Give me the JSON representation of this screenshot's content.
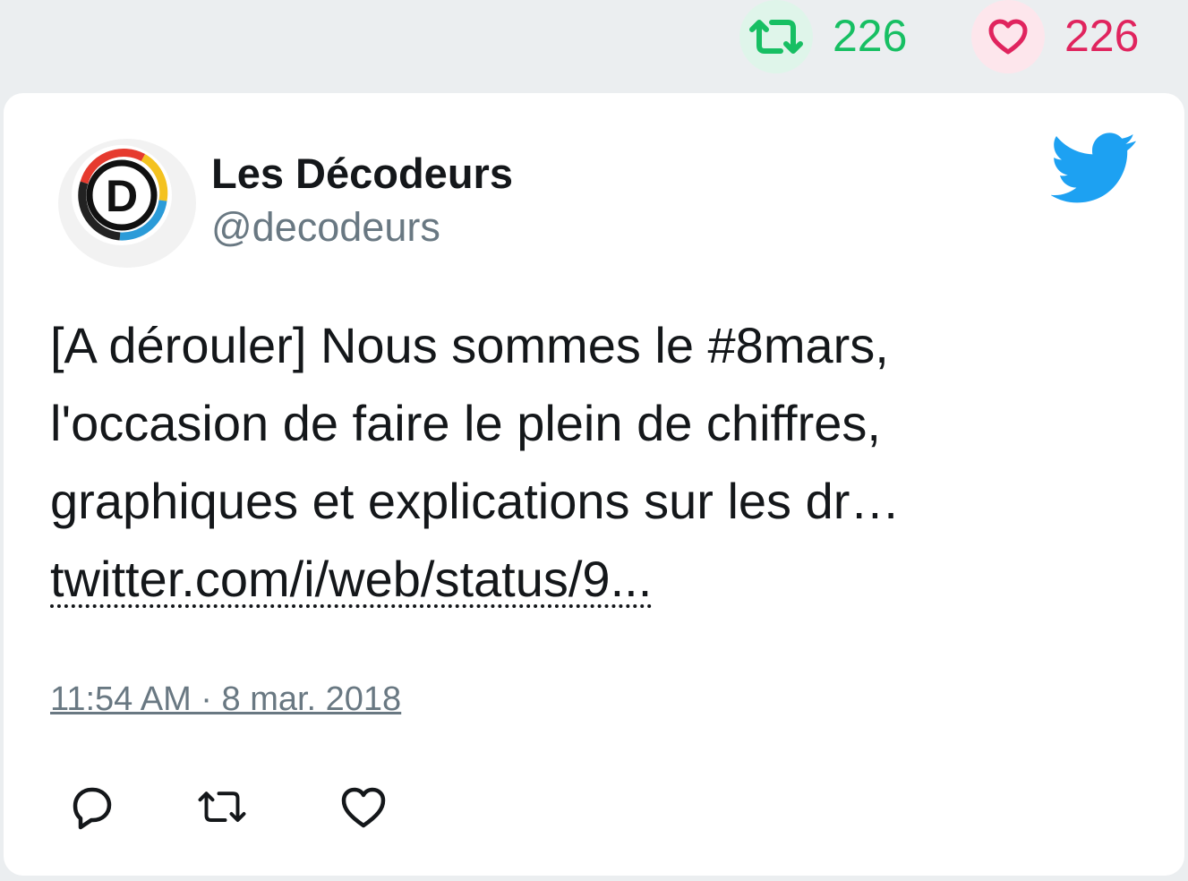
{
  "stats": {
    "retweet_icon": "retweet-icon",
    "retweet_count": "226",
    "like_icon": "heart-icon",
    "like_count": "226",
    "colors": {
      "retweet": "#17bf63",
      "like": "#e0245e"
    }
  },
  "tweet": {
    "author": {
      "name": "Les Décodeurs",
      "handle": "@decodeurs",
      "avatar_letter": "D"
    },
    "text_lines": [
      "[A dérouler] Nous sommes le #8mars,",
      "l'occasion de faire le plein de chiffres,",
      "graphiques et explications sur les dr…"
    ],
    "link_text": "twitter.com/i/web/status/9...",
    "timestamp": "11:54 AM · 8 mar. 2018"
  },
  "actions": {
    "reply_icon": "reply-icon",
    "retweet_icon": "retweet-icon",
    "like_icon": "heart-icon"
  },
  "brand": {
    "logo_icon": "twitter-bird-icon",
    "color": "#1da1f2"
  }
}
